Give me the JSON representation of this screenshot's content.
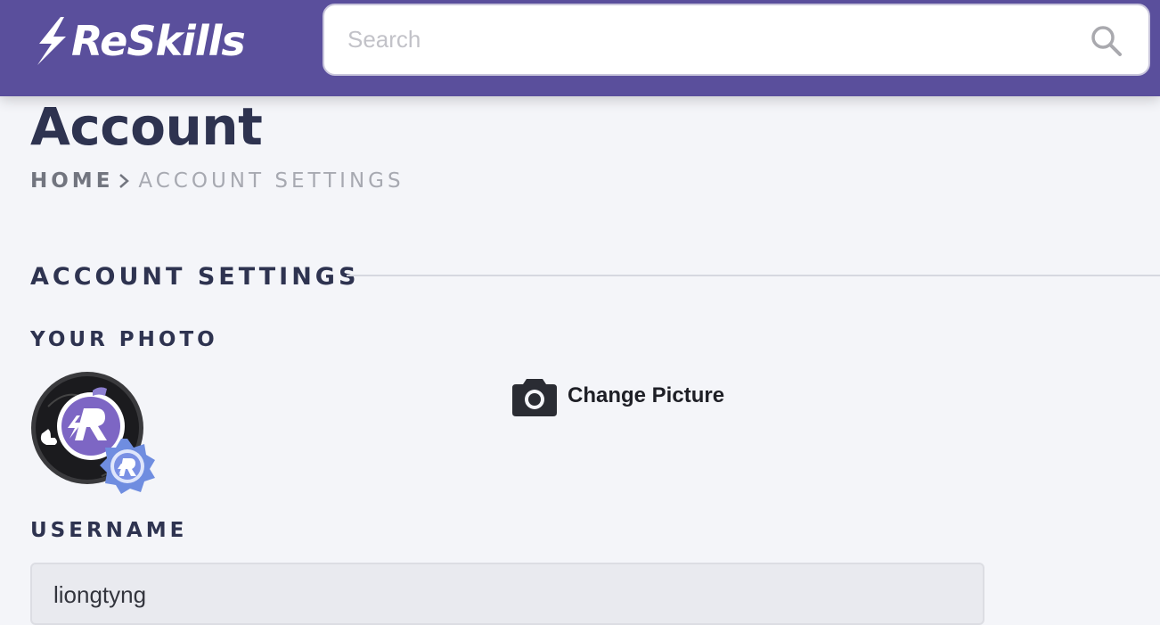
{
  "header": {
    "logo_text": "ReSkills",
    "search": {
      "placeholder": "Search",
      "value": ""
    },
    "brand_color": "#5a4f9c"
  },
  "page": {
    "title": "Account",
    "breadcrumb": {
      "home": "HOME",
      "current": "ACCOUNT SETTINGS"
    }
  },
  "account_settings": {
    "heading": "ACCOUNT SETTINGS",
    "photo": {
      "label": "YOUR PHOTO",
      "change_label": "Change Picture"
    },
    "username": {
      "label": "USERNAME",
      "value": "liongtyng"
    }
  },
  "icons": [
    "logo-bolt-icon",
    "search-icon",
    "chevron-right-icon",
    "camera-icon",
    "verified-badge-icon"
  ]
}
